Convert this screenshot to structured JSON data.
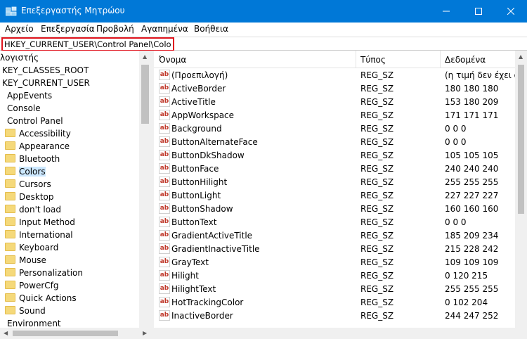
{
  "window": {
    "title": "Επεξεργαστής Μητρώου"
  },
  "menu": [
    "Αρχείο",
    "Επεξεργασία",
    "Προβολή",
    "Αγαπημένα",
    "Βοήθεια"
  ],
  "address": {
    "value": "HKEY_CURRENT_USER\\Control Panel\\Colors"
  },
  "tree": [
    {
      "label": "λογιστής",
      "folder": false,
      "selected": false
    },
    {
      "label": "KEY_CLASSES_ROOT",
      "folder": false,
      "selected": false
    },
    {
      "label": "KEY_CURRENT_USER",
      "folder": false,
      "selected": false
    },
    {
      "label": "AppEvents",
      "folder": false,
      "selected": false
    },
    {
      "label": "Console",
      "folder": false,
      "selected": false
    },
    {
      "label": "Control Panel",
      "folder": false,
      "selected": false
    },
    {
      "label": "Accessibility",
      "folder": true,
      "selected": false
    },
    {
      "label": "Appearance",
      "folder": true,
      "selected": false
    },
    {
      "label": "Bluetooth",
      "folder": true,
      "selected": false
    },
    {
      "label": "Colors",
      "folder": true,
      "selected": true
    },
    {
      "label": "Cursors",
      "folder": true,
      "selected": false
    },
    {
      "label": "Desktop",
      "folder": true,
      "selected": false
    },
    {
      "label": "don't load",
      "folder": true,
      "selected": false
    },
    {
      "label": "Input Method",
      "folder": true,
      "selected": false
    },
    {
      "label": "International",
      "folder": true,
      "selected": false
    },
    {
      "label": "Keyboard",
      "folder": true,
      "selected": false
    },
    {
      "label": "Mouse",
      "folder": true,
      "selected": false
    },
    {
      "label": "Personalization",
      "folder": true,
      "selected": false
    },
    {
      "label": "PowerCfg",
      "folder": true,
      "selected": false
    },
    {
      "label": "Quick Actions",
      "folder": true,
      "selected": false
    },
    {
      "label": "Sound",
      "folder": true,
      "selected": false
    },
    {
      "label": "Environment",
      "folder": false,
      "selected": false
    }
  ],
  "list": {
    "headers": [
      "Όνομα",
      "Τύπος",
      "Δεδομένα"
    ],
    "rows": [
      {
        "name": "(Προεπιλογή)",
        "type": "REG_SZ",
        "data": "(η τιμή δεν έχει ορι"
      },
      {
        "name": "ActiveBorder",
        "type": "REG_SZ",
        "data": "180 180 180"
      },
      {
        "name": "ActiveTitle",
        "type": "REG_SZ",
        "data": "153 180 209"
      },
      {
        "name": "AppWorkspace",
        "type": "REG_SZ",
        "data": "171 171 171"
      },
      {
        "name": "Background",
        "type": "REG_SZ",
        "data": "0 0 0"
      },
      {
        "name": "ButtonAlternateFace",
        "type": "REG_SZ",
        "data": "0 0 0"
      },
      {
        "name": "ButtonDkShadow",
        "type": "REG_SZ",
        "data": "105 105 105"
      },
      {
        "name": "ButtonFace",
        "type": "REG_SZ",
        "data": "240 240 240"
      },
      {
        "name": "ButtonHilight",
        "type": "REG_SZ",
        "data": "255 255 255"
      },
      {
        "name": "ButtonLight",
        "type": "REG_SZ",
        "data": "227 227 227"
      },
      {
        "name": "ButtonShadow",
        "type": "REG_SZ",
        "data": "160 160 160"
      },
      {
        "name": "ButtonText",
        "type": "REG_SZ",
        "data": "0 0 0"
      },
      {
        "name": "GradientActiveTitle",
        "type": "REG_SZ",
        "data": "185 209 234"
      },
      {
        "name": "GradientInactiveTitle",
        "type": "REG_SZ",
        "data": "215 228 242"
      },
      {
        "name": "GrayText",
        "type": "REG_SZ",
        "data": "109 109 109"
      },
      {
        "name": "Hilight",
        "type": "REG_SZ",
        "data": "0 120 215"
      },
      {
        "name": "HilightText",
        "type": "REG_SZ",
        "data": "255 255 255"
      },
      {
        "name": "HotTrackingColor",
        "type": "REG_SZ",
        "data": "0 102 204"
      },
      {
        "name": "InactiveBorder",
        "type": "REG_SZ",
        "data": "244 247 252"
      }
    ]
  },
  "icons": {
    "value": "ab"
  },
  "colors": {
    "titlebar": "#0078d7",
    "selection": "#cce8ff",
    "highlight_box": "#e0131d"
  }
}
